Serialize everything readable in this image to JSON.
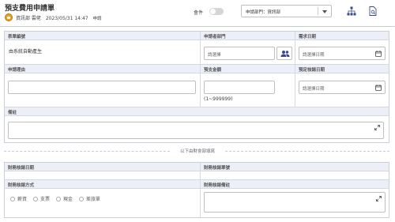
{
  "header": {
    "title": "預支費用申請單",
    "applicant": "資訊部 雲佬",
    "date": "2023/05/31 14:47",
    "status": "申請",
    "toggle_label": "會件",
    "dept_select": "申請部門：資訊部"
  },
  "form": {
    "row1": {
      "doc_no_label": "表單編號",
      "doc_no_value": "由系統自動產生",
      "dept_label": "申請者部門",
      "dept_placeholder": "請選擇",
      "need_date_label": "需求日期",
      "need_date_placeholder": "請選擇日期"
    },
    "row2": {
      "reason_label": "申請理由",
      "amount_label": "預支金額",
      "amount_hint": "(1~999999)",
      "settle_date_label": "預定核銷日期",
      "settle_date_placeholder": "請選擇日期"
    },
    "row3": {
      "remark_label": "備註"
    },
    "divider": "以下由財會部填寫",
    "row4": {
      "fin_date_label": "財務核銷日期",
      "fin_no_label": "財務核銷單號"
    },
    "row5": {
      "method_label": "財務核銷方式",
      "methods": [
        "薪資",
        "支票",
        "現金",
        "差旅單"
      ],
      "fin_remark_label": "財務核銷備註"
    }
  }
}
